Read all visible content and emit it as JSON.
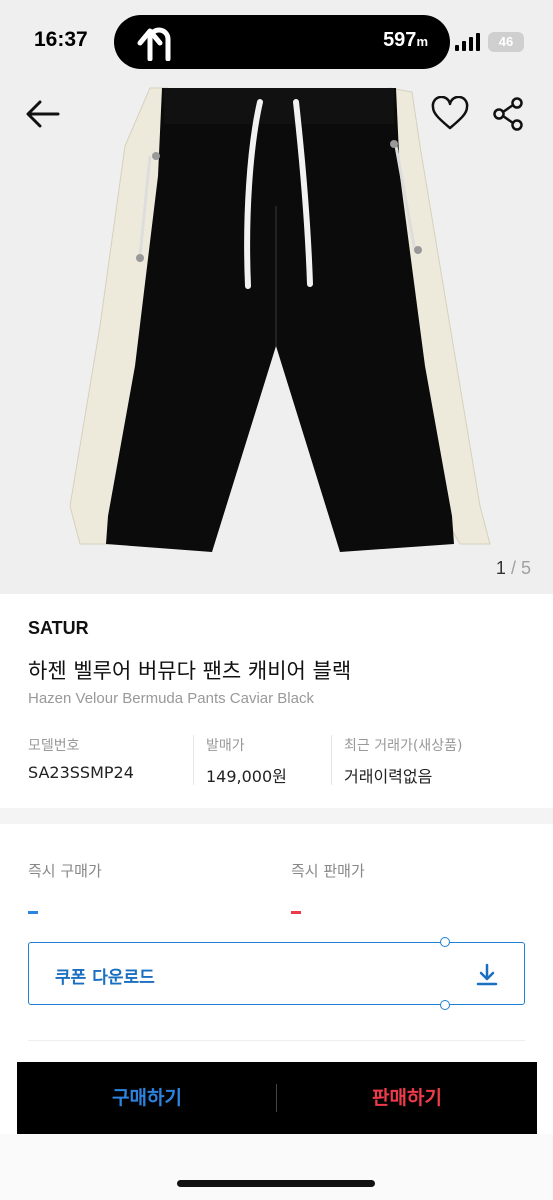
{
  "status_bar": {
    "time": "16:37",
    "nav_distance": "597",
    "nav_unit": "m",
    "battery": "46",
    "icons": [
      "u-turn-arrow-icon",
      "signal-bars-icon",
      "battery-icon"
    ]
  },
  "gallery": {
    "current": "1",
    "separator": "/",
    "total": "5",
    "icons": [
      "back-arrow-icon",
      "heart-icon",
      "share-icon"
    ]
  },
  "product": {
    "brand": "SATUR",
    "name_ko": "하젠 벨루어 버뮤다 팬츠 캐비어 블랙",
    "name_en": "Hazen Velour Bermuda Pants Caviar Black",
    "specs": [
      {
        "label": "모델번호",
        "value": "SA23SSMP24"
      },
      {
        "label": "발매가",
        "value": "149,000원"
      },
      {
        "label": "최근 거래가(새상품)",
        "value": "거래이력없음"
      }
    ]
  },
  "prices": {
    "buy_label": "즉시 구매가",
    "sell_label": "즉시 판매가"
  },
  "coupon": {
    "label": "쿠폰 다운로드",
    "icon": "download-icon"
  },
  "actions": {
    "buy": "구매하기",
    "sell": "판매하기"
  },
  "colors": {
    "buy_accent": "#2d84e0",
    "sell_accent": "#ef3a4a",
    "coupon_border": "#1e80d6",
    "action_bar_bg": "#000000"
  }
}
